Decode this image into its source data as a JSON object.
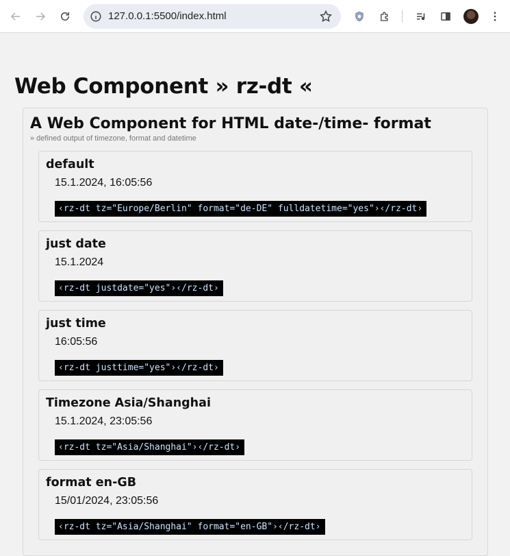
{
  "browser": {
    "url": "127.0.0.1:5500/index.html"
  },
  "page": {
    "title": "Web Component » rz-dt «",
    "section_title": "A Web Component for HTML date-/time- format",
    "section_subtitle": "» defined output of timezone, format and datetime",
    "examples": [
      {
        "heading": "default",
        "value": "15.1.2024, 16:05:56",
        "code": "‹rz-dt tz=\"Europe/Berlin\" format=\"de-DE\" fulldatetime=\"yes\"›‹/rz-dt›"
      },
      {
        "heading": "just date",
        "value": "15.1.2024",
        "code": "‹rz-dt justdate=\"yes\"›‹/rz-dt›"
      },
      {
        "heading": "just time",
        "value": "16:05:56",
        "code": "‹rz-dt justtime=\"yes\"›‹/rz-dt›"
      },
      {
        "heading": "Timezone Asia/Shanghai",
        "value": "15.1.2024, 23:05:56",
        "code": "‹rz-dt tz=\"Asia/Shanghai\"›‹/rz-dt›"
      },
      {
        "heading": "format en-GB",
        "value": "15/01/2024, 23:05:56",
        "code": "‹rz-dt tz=\"Asia/Shanghai\" format=\"en-GB\"›‹/rz-dt›"
      }
    ]
  }
}
